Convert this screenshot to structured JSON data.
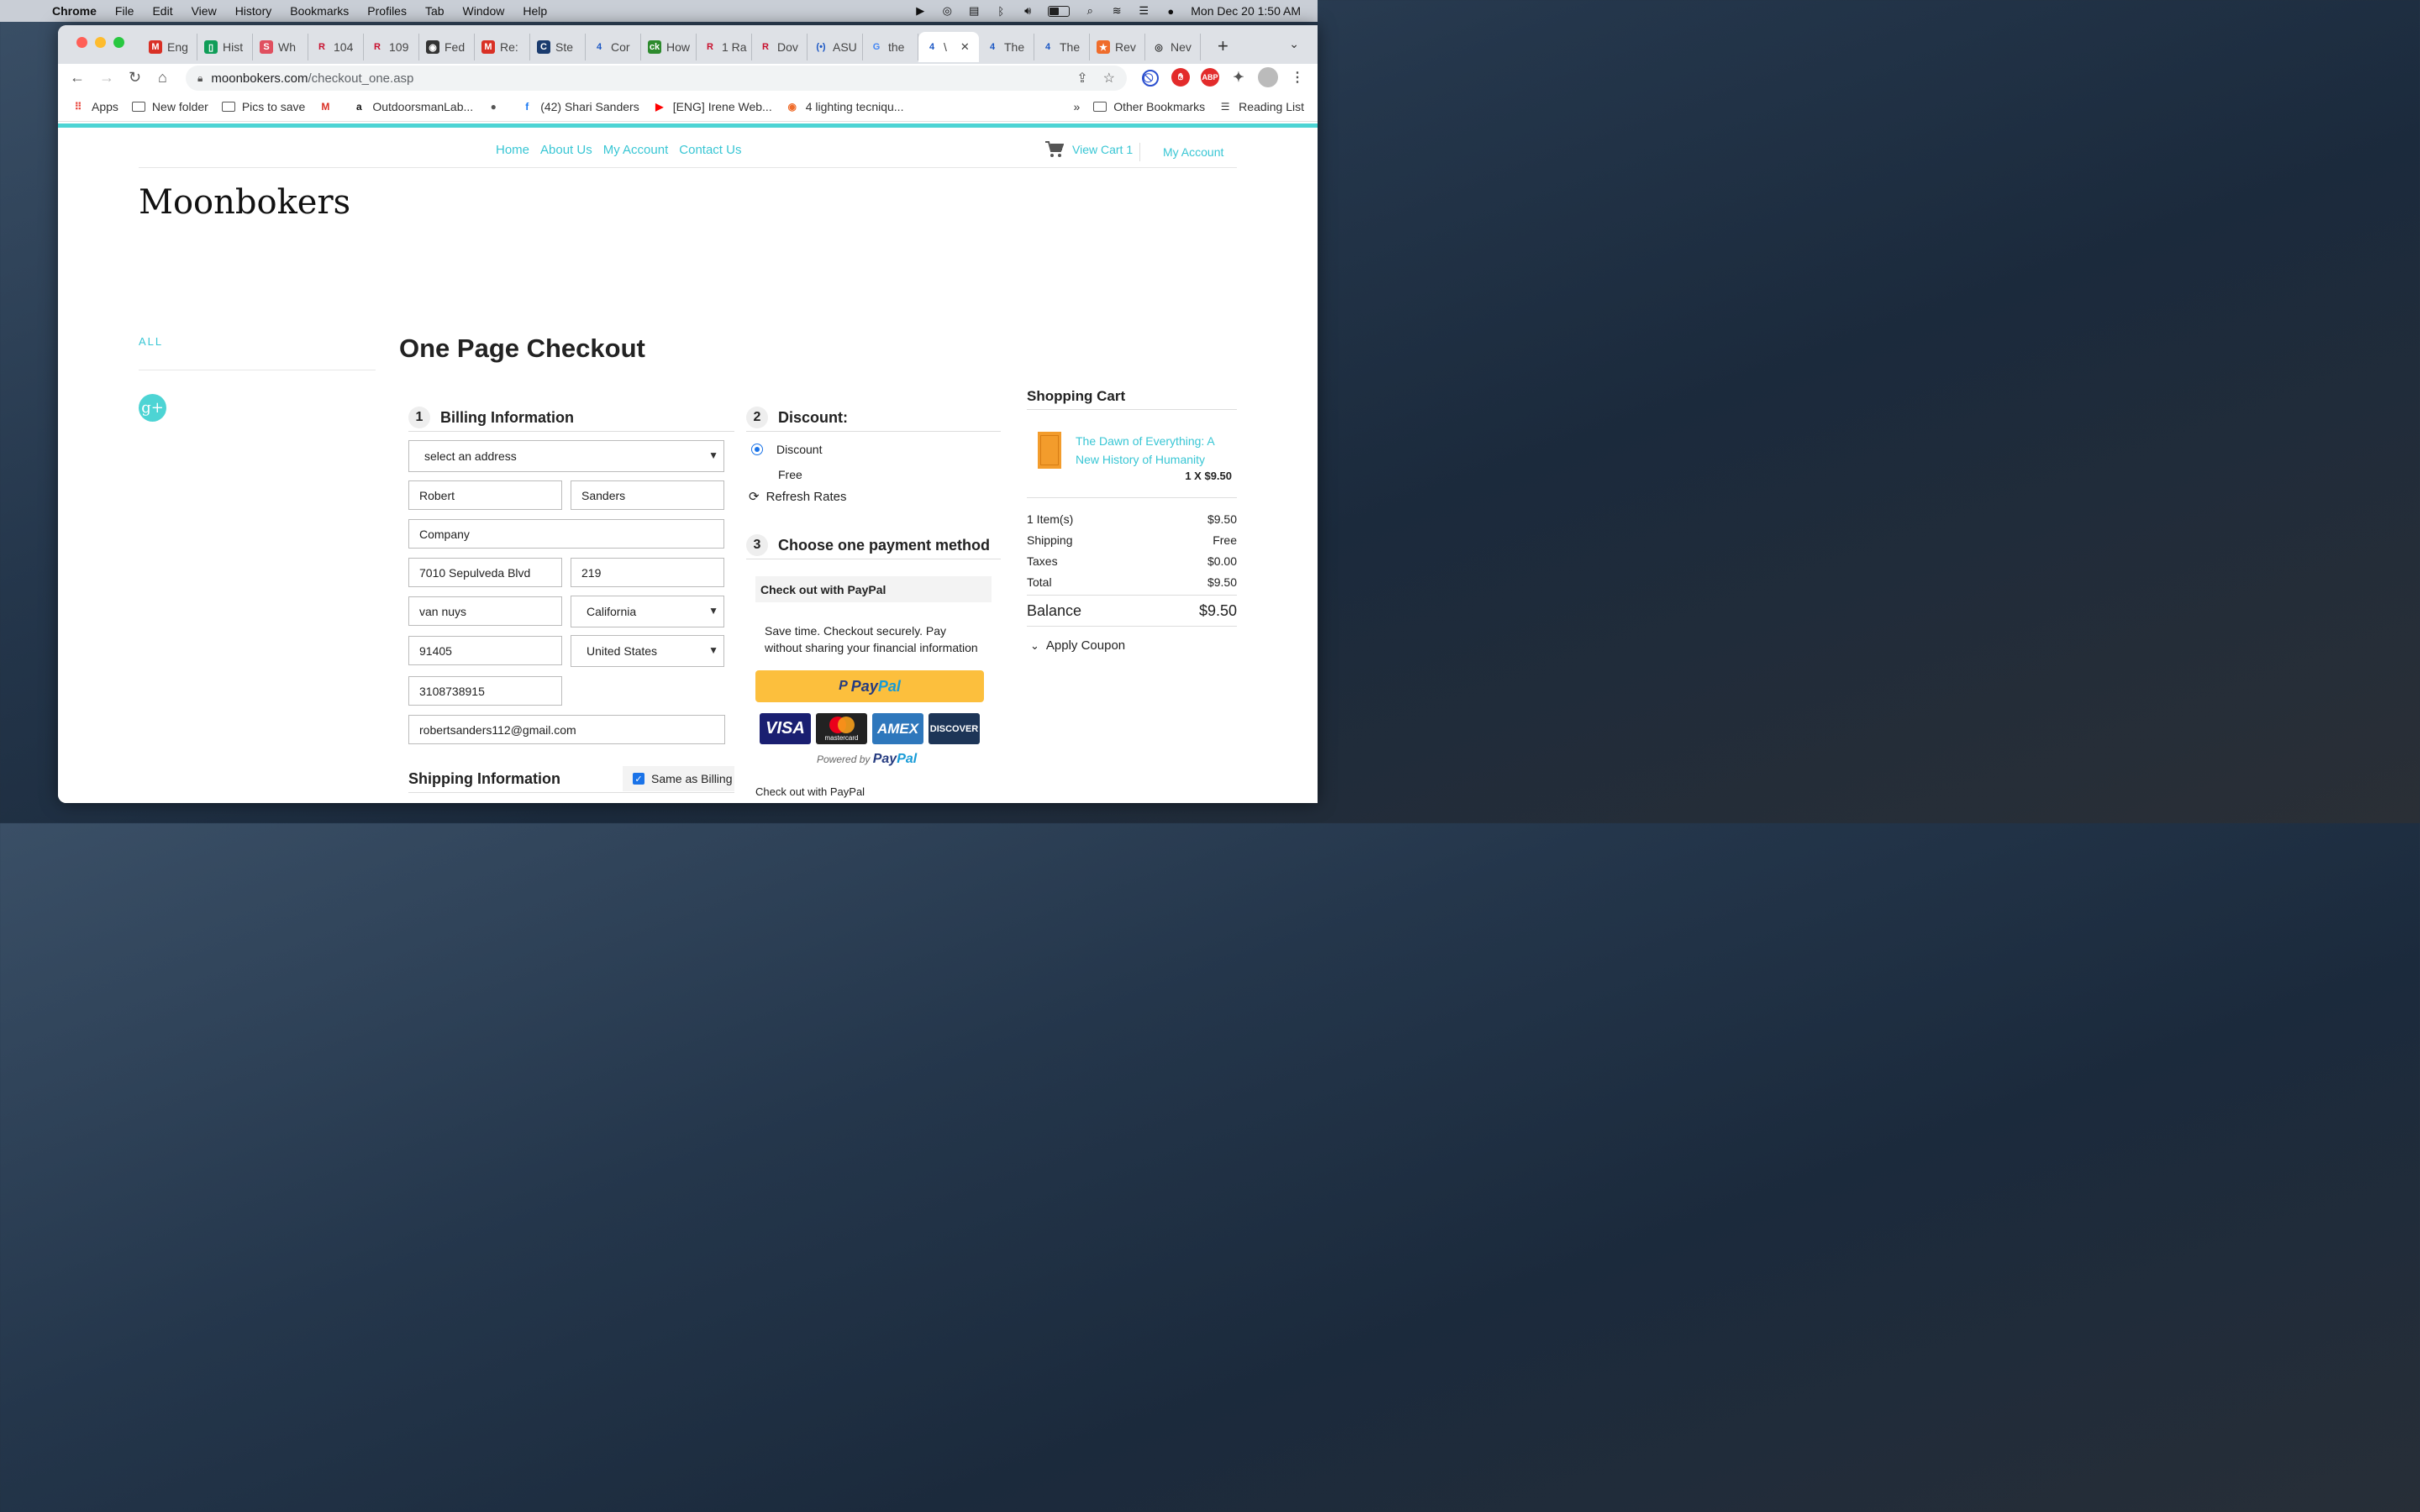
{
  "menubar": {
    "app": "Chrome",
    "items": [
      "File",
      "Edit",
      "View",
      "History",
      "Bookmarks",
      "Profiles",
      "Tab",
      "Window",
      "Help"
    ],
    "clock": "Mon Dec 20  1:50 AM"
  },
  "tabs": [
    {
      "label": "Eng",
      "icon": "gmail-icon"
    },
    {
      "label": "Hist",
      "icon": "sheets-icon"
    },
    {
      "label": "Wh",
      "icon": "s-icon"
    },
    {
      "label": "104",
      "icon": "r-icon"
    },
    {
      "label": "109",
      "icon": "r-icon"
    },
    {
      "label": "Fed",
      "icon": "fsa-icon"
    },
    {
      "label": "Re:",
      "icon": "gmail-icon"
    },
    {
      "label": "Ste",
      "icon": "steps-icon"
    },
    {
      "label": "Cor",
      "icon": "four-icon"
    },
    {
      "label": "How",
      "icon": "ck-icon"
    },
    {
      "label": "1 Ra",
      "icon": "r-icon"
    },
    {
      "label": "Dov",
      "icon": "r-icon"
    },
    {
      "label": "ASU",
      "icon": "signal-icon"
    },
    {
      "label": "the",
      "icon": "google-icon"
    },
    {
      "label": "\\",
      "icon": "four-icon",
      "active": true
    },
    {
      "label": "The",
      "icon": "four-icon"
    },
    {
      "label": "The",
      "icon": "four-icon"
    },
    {
      "label": "Rev",
      "icon": "star-icon"
    },
    {
      "label": "Nev",
      "icon": "chrome-icon"
    }
  ],
  "address": {
    "domain": "moonbokers.com",
    "path": "/checkout_one.asp"
  },
  "bookmarks": [
    {
      "label": "Apps",
      "icon": "apps-grid-icon"
    },
    {
      "label": "New folder",
      "icon": "folder-icon"
    },
    {
      "label": "Pics to save",
      "icon": "folder-icon"
    },
    {
      "label": "",
      "icon": "gmail-icon"
    },
    {
      "label": "OutdoorsmanLab...",
      "icon": "amazon-icon"
    },
    {
      "label": "",
      "icon": "globe-icon"
    },
    {
      "label": "(42) Shari Sanders",
      "icon": "facebook-icon"
    },
    {
      "label": "[ENG] Irene Web...",
      "icon": "youtube-icon"
    },
    {
      "label": "4 lighting tecniqu...",
      "icon": "orange-icon"
    }
  ],
  "bookmarks_right": {
    "more": "»",
    "other": "Other Bookmarks",
    "reading": "Reading List"
  },
  "site": {
    "nav": [
      "Home",
      "About Us",
      "My Account",
      "Contact Us"
    ],
    "cart_link": "View Cart 1",
    "my_account": "My Account",
    "brand": "Moonbokers",
    "sidebar_all": "ALL",
    "gplus": "g+"
  },
  "checkout": {
    "title": "One Page Checkout",
    "billing": {
      "num": "1",
      "title": "Billing Information",
      "address_select": "select an address",
      "first_name": "Robert",
      "last_name": "Sanders",
      "company": "Company",
      "address1": "7010 Sepulveda Blvd",
      "address2": "219",
      "city": "van nuys",
      "state": "California",
      "zip": "91405",
      "country": "United States",
      "phone": "3108738915",
      "email": "robertsanders112@gmail.com"
    },
    "shipping": {
      "title": "Shipping Information",
      "same_as_billing": "Same as Billing",
      "checked": true
    },
    "discount": {
      "num": "2",
      "title": "Discount:",
      "option": "Discount",
      "free": "Free",
      "refresh": "Refresh Rates"
    },
    "payment": {
      "num": "3",
      "title": "Choose one payment method",
      "paypal_head": "Check out with PayPal",
      "paypal_text": "Save time. Checkout securely. Pay without sharing your financial information",
      "paypal_btn_a": "Pay",
      "paypal_btn_b": "Pal",
      "cards": [
        "VISA",
        "mastercard",
        "AMEX",
        "DISCOVER"
      ],
      "powered_prefix": "Powered by",
      "powered_pay": "Pay",
      "powered_pal": "Pal",
      "footer": "Check out with PayPal"
    }
  },
  "cart": {
    "title": "Shopping Cart",
    "item": {
      "title": "The Dawn of Everything: A New History of Humanity",
      "qty": "1 X $9.50"
    },
    "rows": [
      {
        "label": "1 Item(s)",
        "value": "$9.50"
      },
      {
        "label": "Shipping",
        "value": "Free"
      },
      {
        "label": "Taxes",
        "value": "$0.00"
      },
      {
        "label": "Total",
        "value": "$9.50"
      }
    ],
    "balance_label": "Balance",
    "balance_value": "$9.50",
    "coupon": "Apply Coupon"
  }
}
